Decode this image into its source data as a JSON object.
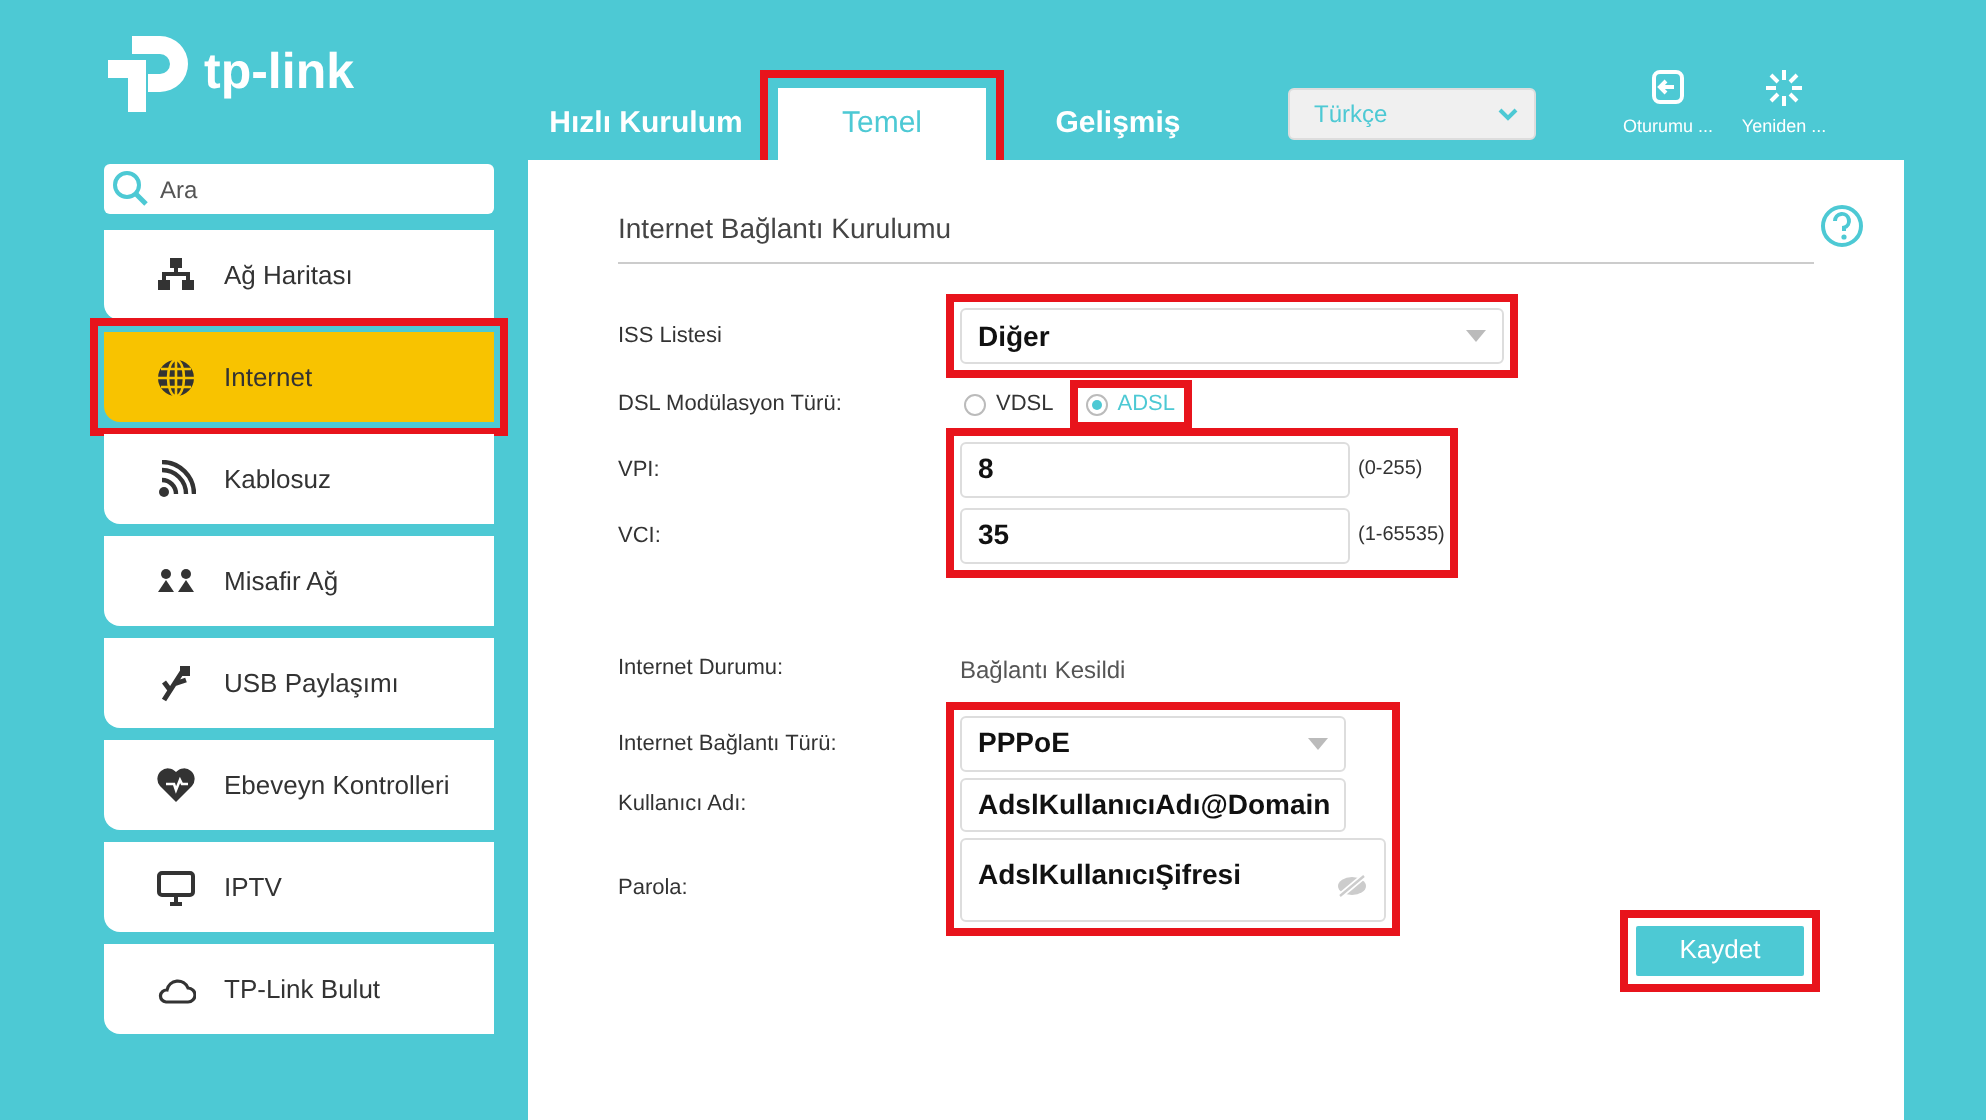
{
  "logo": {
    "text": "tp-link"
  },
  "nav": {
    "tabs": [
      {
        "label": "Hızlı Kurulum",
        "selected": false,
        "highlighted": false
      },
      {
        "label": "Temel",
        "selected": true,
        "highlighted": true
      },
      {
        "label": "Gelişmiş",
        "selected": false,
        "highlighted": false
      }
    ],
    "language": "Türkçe",
    "actions": [
      {
        "label": "Oturumu ..."
      },
      {
        "label": "Yeniden ..."
      }
    ]
  },
  "sidebar": {
    "search": {
      "placeholder": "Ara"
    },
    "items": [
      {
        "label": "Ağ Haritası",
        "selected": false,
        "highlighted": false
      },
      {
        "label": "Internet",
        "selected": true,
        "highlighted": true
      },
      {
        "label": "Kablosuz",
        "selected": false,
        "highlighted": false
      },
      {
        "label": "Misafir Ağ",
        "selected": false,
        "highlighted": false
      },
      {
        "label": "USB Paylaşımı",
        "selected": false,
        "highlighted": false
      },
      {
        "label": "Ebeveyn Kontrolleri",
        "selected": false,
        "highlighted": false
      },
      {
        "label": "IPTV",
        "selected": false,
        "highlighted": false
      },
      {
        "label": "TP-Link Bulut",
        "selected": false,
        "highlighted": false
      }
    ]
  },
  "panel": {
    "title": "Internet Bağlantı Kurulumu",
    "isp": {
      "label": "ISS Listesi",
      "value": "Diğer",
      "highlighted": true
    },
    "dsl": {
      "label": "DSL Modülasyon Türü:",
      "options": [
        {
          "label": "VDSL",
          "selected": false,
          "highlighted": false
        },
        {
          "label": "ADSL",
          "selected": true,
          "highlighted": true
        }
      ]
    },
    "vc": {
      "highlighted": true,
      "fields": [
        {
          "label": "VPI:",
          "value": "8",
          "hint": "(0-255)"
        },
        {
          "label": "VCI:",
          "value": "35",
          "hint": "(1-65535)"
        }
      ]
    },
    "status": {
      "label": "Internet Durumu:",
      "value": "Bağlantı Kesildi"
    },
    "connection": {
      "highlighted": true,
      "fields": [
        {
          "kind": "select",
          "label": "Internet Bağlantı Türü:",
          "value": "PPPoE"
        },
        {
          "kind": "text",
          "label": "Kullanıcı Adı:",
          "value": "AdslKullanıcıAdı@Domain"
        },
        {
          "kind": "password",
          "label": "Parola:",
          "value": "AdslKullanıcıŞifresi"
        }
      ]
    },
    "save": {
      "label": "Kaydet",
      "highlighted": true
    }
  }
}
